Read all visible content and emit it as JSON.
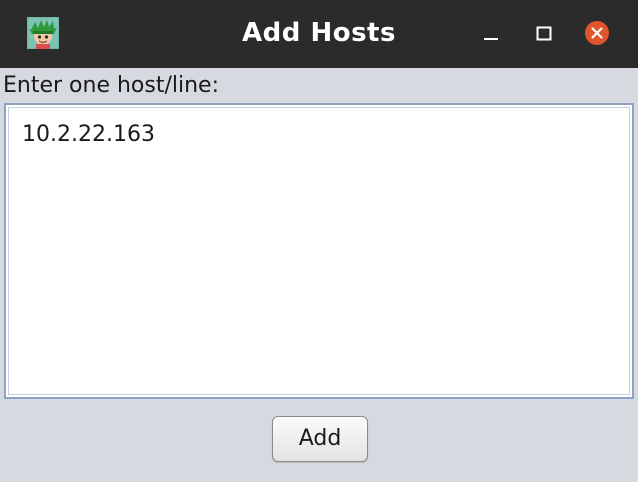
{
  "window": {
    "title": "Add Hosts",
    "app_icon": "app-mascot-icon",
    "controls": {
      "minimize": "minimize-icon",
      "maximize": "maximize-icon",
      "close": "close-icon",
      "close_color": "#e0552b"
    }
  },
  "form": {
    "prompt": "Enter one host/line:",
    "hosts_text": "10.2.22.163",
    "add_label": "Add"
  },
  "colors": {
    "titlebar": "#2b2b2b",
    "background": "#d6d9df",
    "field_border": "#8ea2c3"
  }
}
